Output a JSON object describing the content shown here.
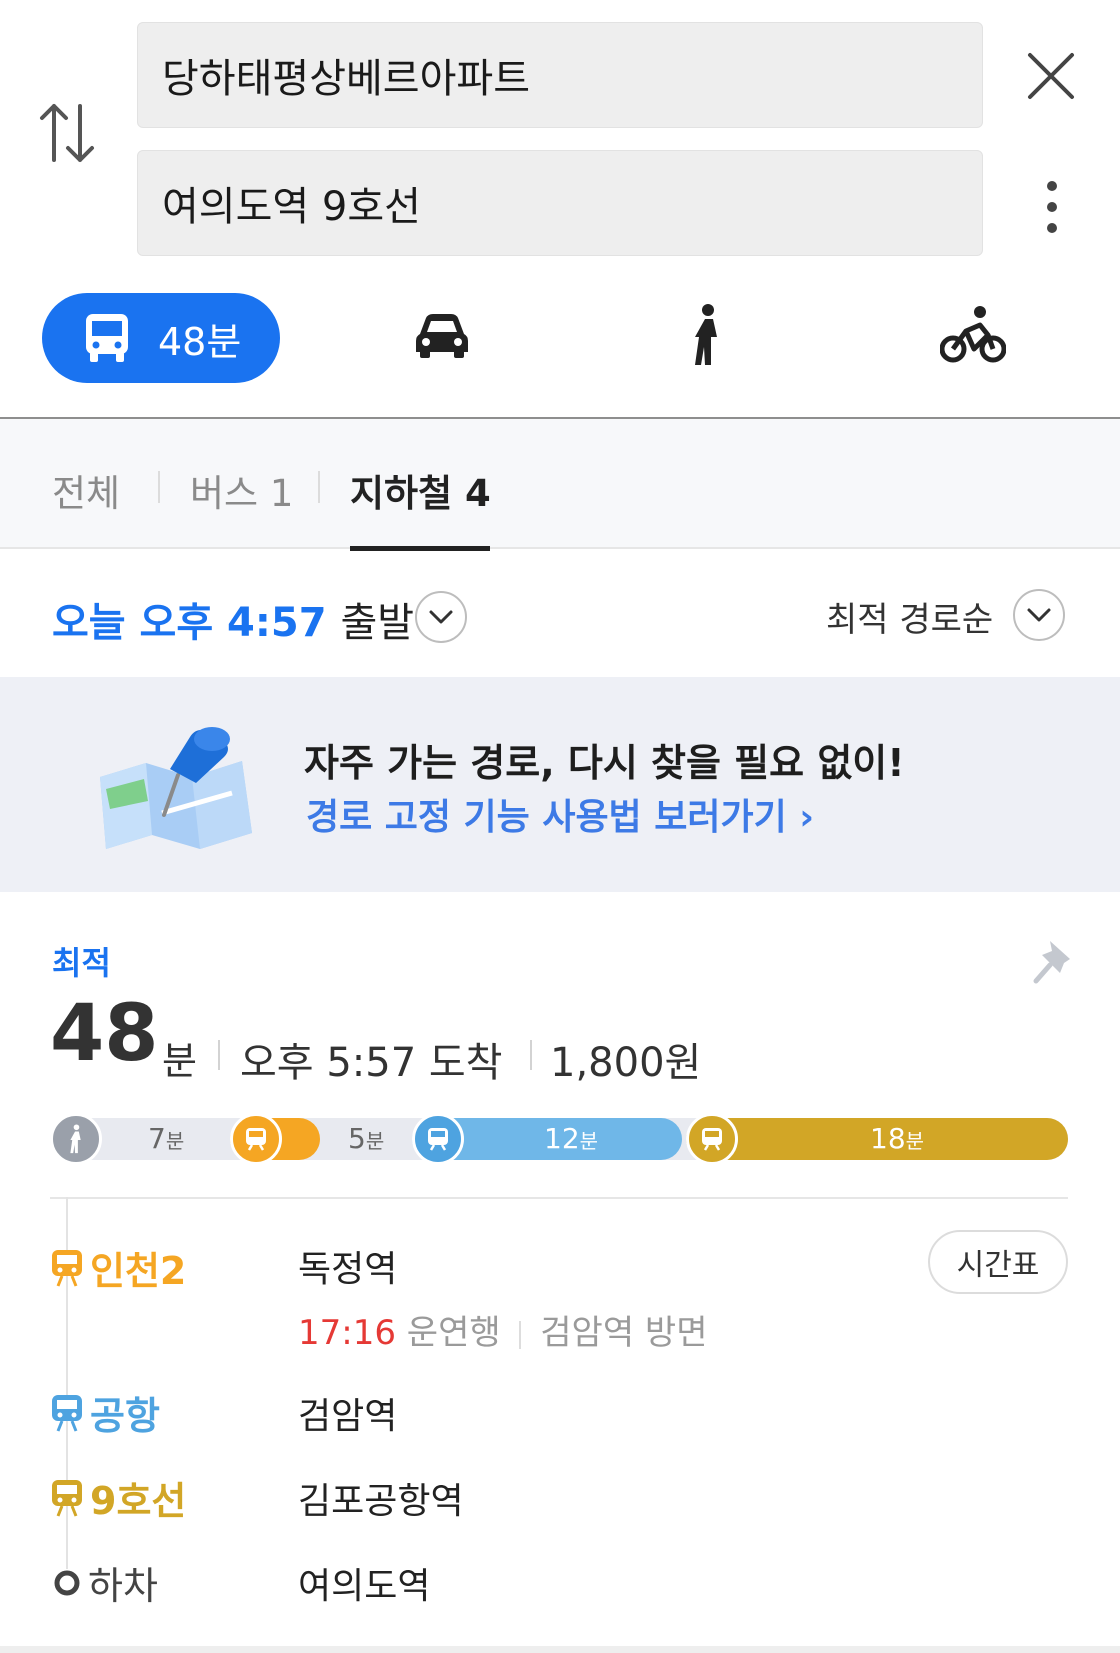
{
  "search": {
    "origin": "당하태평상베르아파트",
    "destination": "여의도역 9호선"
  },
  "modes": {
    "transit_time": "48분"
  },
  "subtabs": [
    {
      "label": "전체"
    },
    {
      "label": "버스 1"
    },
    {
      "label": "지하철 4"
    }
  ],
  "depart": {
    "time_text": "오늘 오후 4:57",
    "suffix": "출발"
  },
  "sort": {
    "label": "최적 경로순"
  },
  "banner": {
    "title": "자주 가는 경로, 다시 찾을 필요 없이!",
    "link": "경로 고정 기능 사용법 보러가기 ›"
  },
  "route": {
    "badge": "최적",
    "duration_num": "48",
    "duration_unit": "분",
    "arrival": "오후 5:57 도착",
    "fare": "1,800원",
    "segments": [
      {
        "type": "walk",
        "num": "7",
        "unit": "분",
        "color": "#9aa0aa"
      },
      {
        "type": "subway-incheon2",
        "num": "5",
        "unit": "분",
        "color": "#f5a623"
      },
      {
        "type": "subway-airport",
        "num": "12",
        "unit": "분",
        "color": "#6fb7e8"
      },
      {
        "type": "subway-line9",
        "num": "18",
        "unit": "분",
        "color": "#d2a626"
      }
    ],
    "steps": [
      {
        "line": "인천2",
        "color": "#f5a623",
        "station": "독정역"
      },
      {
        "line": "공항",
        "color": "#5aaee6",
        "station": "검암역"
      },
      {
        "line": "9호선",
        "color": "#d2a626",
        "station": "김포공항역"
      },
      {
        "line": "하차",
        "color": "#444444",
        "station": "여의도역"
      }
    ],
    "first_train": {
      "time": "17:16",
      "bound": "운연행",
      "direction": "검암역 방면"
    },
    "timetable_label": "시간표"
  },
  "colors": {
    "accent": "#1a73f0",
    "alert": "#e53935"
  }
}
